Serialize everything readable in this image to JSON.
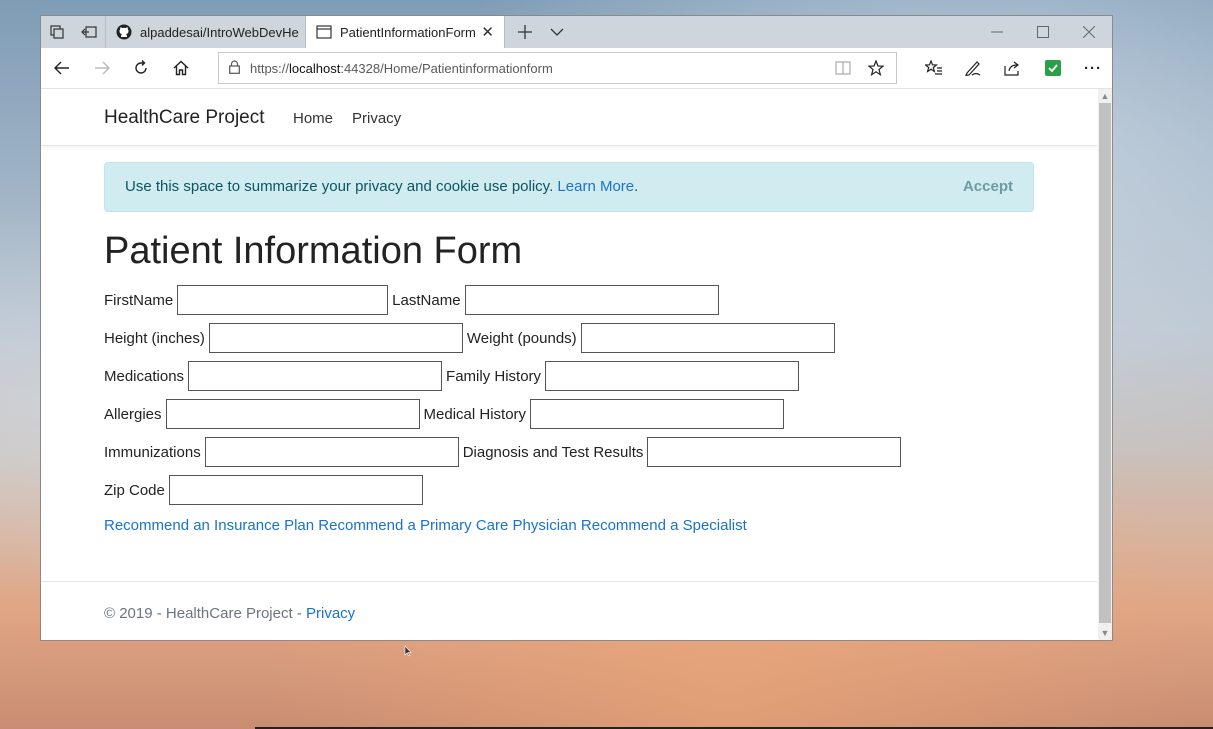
{
  "browser": {
    "tabs": [
      {
        "label": "alpaddesai/IntroWebDevHe",
        "icon": "github-icon"
      },
      {
        "label": "PatientInformationForm",
        "icon": "page-icon"
      }
    ],
    "url_prefix": "https://",
    "url_host": "localhost",
    "url_path": ":44328/Home/Patientinformationform"
  },
  "site": {
    "brand": "HealthCare Project",
    "nav": [
      "Home",
      "Privacy"
    ]
  },
  "cookie": {
    "text": "Use this space to summarize your privacy and cookie use policy.",
    "link": "Learn More",
    "after_link": ".",
    "accept": "Accept"
  },
  "form": {
    "title": "Patient Information Form",
    "labels": {
      "first_name": "FirstName",
      "last_name": "LastName",
      "height": "Height (inches)",
      "weight": "Weight (pounds)",
      "medications": "Medications",
      "family_history": "Family History",
      "allergies": "Allergies",
      "medical_history": "Medical History",
      "immunizations": "Immunizations",
      "diagnosis": "Diagnosis and Test Results",
      "zip": "Zip Code"
    },
    "values": {
      "first_name": "",
      "last_name": "",
      "height": "",
      "weight": "",
      "medications": "",
      "family_history": "",
      "allergies": "",
      "medical_history": "",
      "immunizations": "",
      "diagnosis": "",
      "zip": ""
    }
  },
  "links": {
    "insurance": "Recommend an Insurance Plan",
    "physician": "Recommend a Primary Care Physician",
    "specialist": "Recommend a Specialist"
  },
  "footer": {
    "text": "© 2019 - HealthCare Project - ",
    "privacy": "Privacy"
  }
}
